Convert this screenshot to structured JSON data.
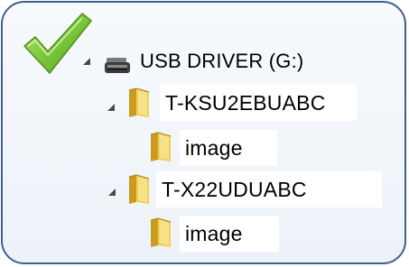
{
  "tree": {
    "drive": {
      "label": "USB DRIVER (G:)",
      "icon": "usb-drive-icon",
      "expanded": true
    },
    "folders": [
      {
        "label": "T-KSU2EBUABC",
        "icon": "folder-icon",
        "expanded": true,
        "children": [
          {
            "label": "image",
            "icon": "folder-icon"
          }
        ]
      },
      {
        "label": "T-X22UDUABC",
        "icon": "folder-icon",
        "expanded": true,
        "children": [
          {
            "label": "image",
            "icon": "folder-icon"
          }
        ]
      }
    ]
  },
  "decoration": {
    "check_icon": "green-checkmark-icon"
  },
  "colors": {
    "border": "#3f5f8c",
    "check_green": "#6fbf2e",
    "folder_yellow": "#e8c13e",
    "expander_gray": "#4a4a4a"
  }
}
